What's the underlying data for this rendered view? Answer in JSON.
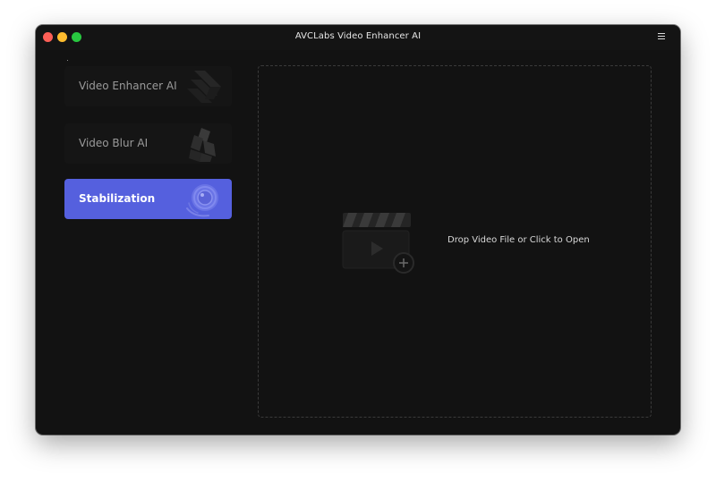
{
  "window": {
    "title": "AVCLabs Video Enhancer AI"
  },
  "colors": {
    "close": "#fe5f57",
    "minimize": "#febc2e",
    "maximize": "#28c840",
    "accent": "#5560de"
  },
  "sidebar": {
    "modes": [
      {
        "label": "Video Enhancer AI",
        "icon": "enhancer-stripes-icon",
        "selected": false
      },
      {
        "label": "Video Blur AI",
        "icon": "blur-blocks-icon",
        "selected": false
      },
      {
        "label": "Stabilization",
        "icon": "stabilization-lens-icon",
        "selected": true
      }
    ]
  },
  "drop_zone": {
    "icon": "video-clapperboard-add-icon",
    "text": "Drop Video File or Click to Open"
  }
}
